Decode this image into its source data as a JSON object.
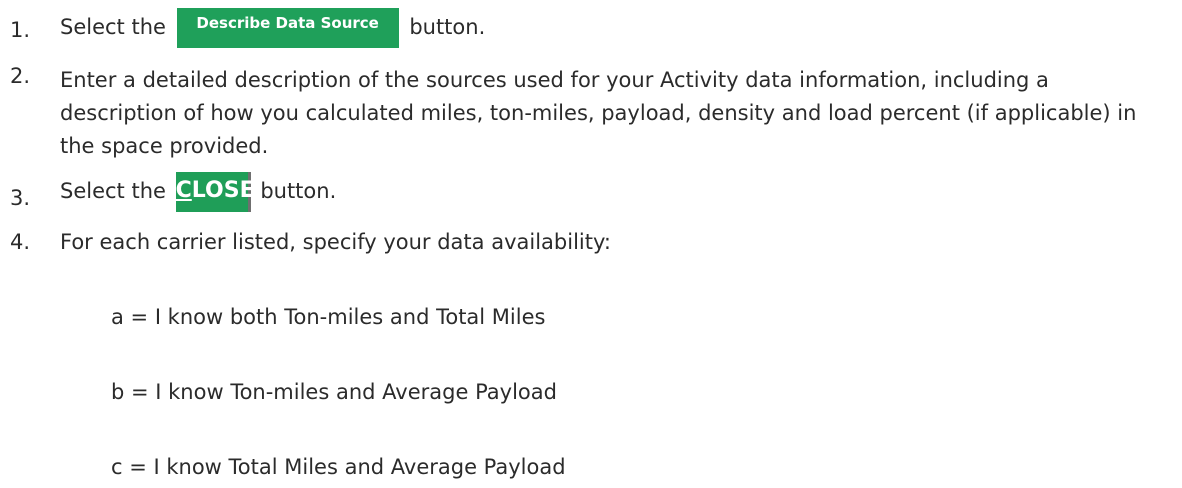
{
  "steps": [
    {
      "number": "1.",
      "prefix": "Select the",
      "button": "Describe Data Source",
      "suffix": "button."
    },
    {
      "number": "2.",
      "text": "Enter a detailed description of the sources used for your Activity data information, including a description of how you calculated miles, ton-miles, payload, density and load percent (if applicable) in the space provided."
    },
    {
      "number": "3.",
      "prefix": "Select the",
      "button_first": "C",
      "button_rest": "LOSE",
      "suffix": "button."
    },
    {
      "number": "4.",
      "text": "For each carrier listed, specify your data availability:"
    }
  ],
  "options": [
    "a = I know both Ton-miles and Total Miles",
    "b = I know Ton-miles and Average Payload",
    "c = I know Total Miles and Average Payload"
  ],
  "colors": {
    "button_green": "#1fa05a",
    "text": "#2b2b2b"
  }
}
